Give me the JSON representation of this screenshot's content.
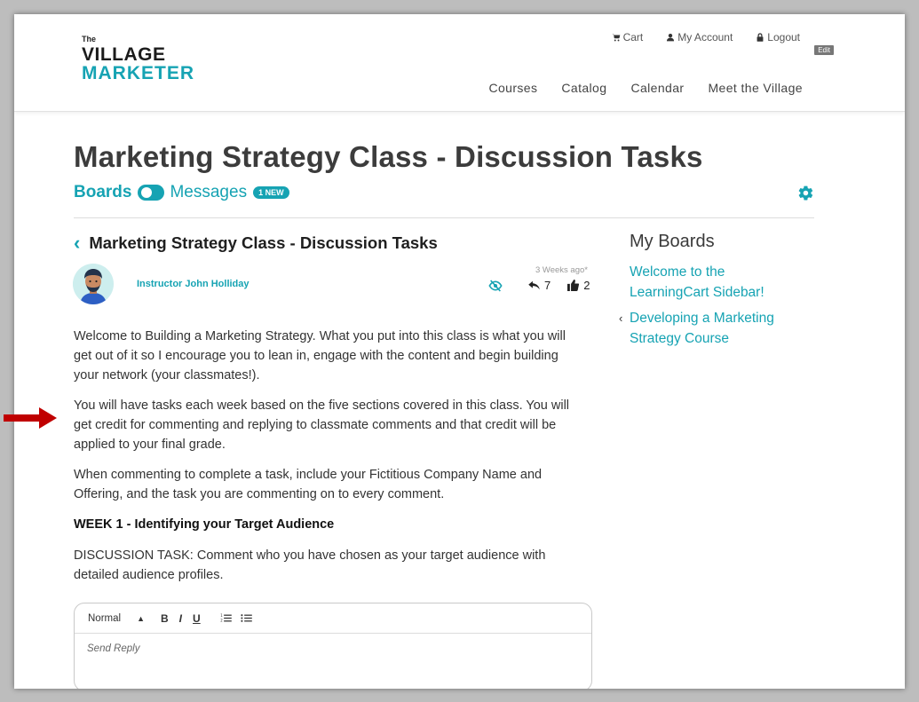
{
  "header": {
    "logo": {
      "the": "The",
      "village": "VILLAGE",
      "marketer": "MARKETER"
    },
    "top_links": [
      {
        "label": "Cart",
        "icon": "cart-icon"
      },
      {
        "label": "My Account",
        "icon": "user-icon"
      },
      {
        "label": "Logout",
        "icon": "lock-icon"
      }
    ],
    "edit_label": "Edit",
    "nav": [
      "Courses",
      "Catalog",
      "Calendar",
      "Meet the Village"
    ]
  },
  "page": {
    "title": "Marketing Strategy Class - Discussion Tasks",
    "boards_label": "Boards",
    "messages_label": "Messages",
    "new_badge": "1 NEW"
  },
  "thread": {
    "title": "Marketing Strategy Class - Discussion Tasks",
    "author": "Instructor John Holliday",
    "time": "3 Weeks ago*",
    "replies": "7",
    "likes": "2",
    "paragraphs": [
      "Welcome to Building a Marketing Strategy. What you put into this class is what you will get out of it so I encourage you to lean in, engage with the content and begin building your network (your classmates!).",
      "You will have tasks each week based on the five sections covered in this class. You will get credit for commenting and replying to classmate comments and that credit will be applied to your final grade.",
      "When commenting to complete a task, include your Fictitious Company Name and Offering, and the task you are commenting on to every comment."
    ],
    "week_heading": "WEEK 1 - Identifying your Target Audience",
    "task": "DISCUSSION TASK: Comment who you have chosen as your target audience with detailed audience profiles."
  },
  "editor": {
    "format_select": "Normal",
    "bold": "B",
    "italic": "I",
    "underline": "U",
    "placeholder": "Send Reply"
  },
  "sidebar": {
    "title": "My Boards",
    "items": [
      {
        "label": "Welcome to the LearningCart Sidebar!"
      },
      {
        "label": "Developing a Marketing Strategy Course"
      }
    ]
  },
  "colors": {
    "accent": "#16a3b3",
    "arrow": "#c00000"
  }
}
